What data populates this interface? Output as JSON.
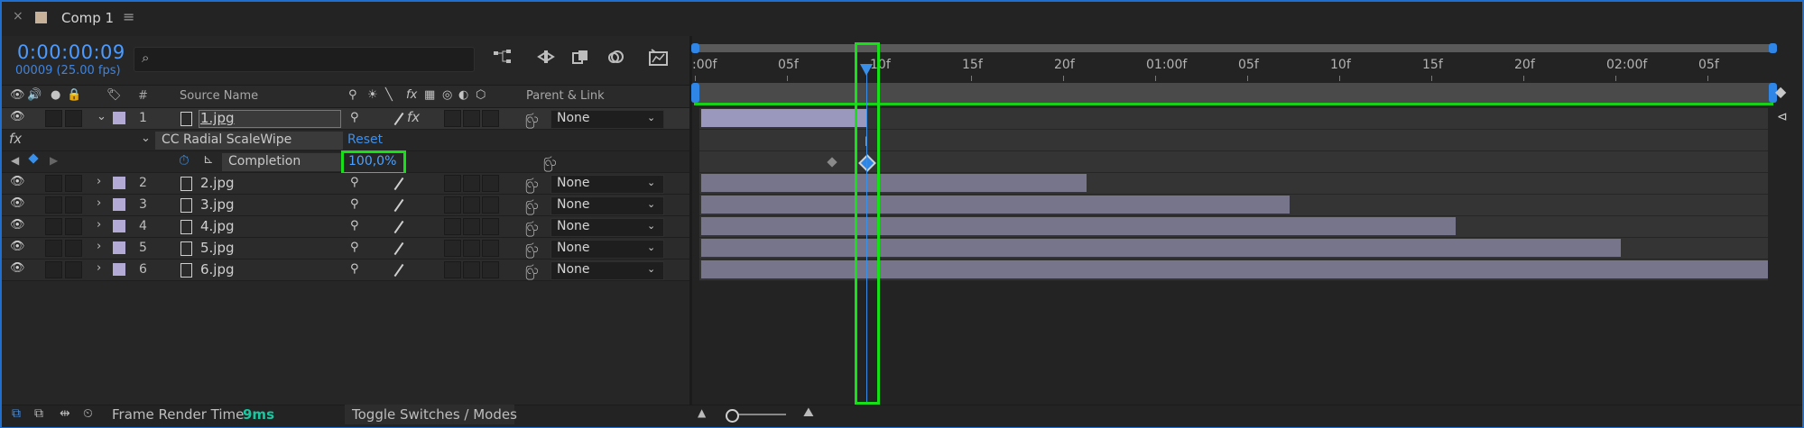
{
  "tab": {
    "close": "×",
    "title": "Comp 1",
    "menu": "≡"
  },
  "timecode": {
    "current": "0:00:00:09",
    "frames": "00009 (25.00 fps)"
  },
  "search": {
    "placeholder": "",
    "glyph": "⌕"
  },
  "columns": {
    "number": "#",
    "source_name": "Source Name",
    "parent_link": "Parent & Link"
  },
  "layers": [
    {
      "number": "1",
      "name": "1.jpg",
      "parent": "None"
    },
    {
      "number": "2",
      "name": "2.jpg",
      "parent": "None"
    },
    {
      "number": "3",
      "name": "3.jpg",
      "parent": "None"
    },
    {
      "number": "4",
      "name": "4.jpg",
      "parent": "None"
    },
    {
      "number": "5",
      "name": "5.jpg",
      "parent": "None"
    },
    {
      "number": "6",
      "name": "6.jpg",
      "parent": "None"
    }
  ],
  "effect": {
    "fx_label": "fx",
    "name": "CC Radial ScaleWipe",
    "reset": "Reset",
    "property": "Completion",
    "value": "100,0%"
  },
  "ruler": {
    "labels": [
      ":00f",
      "05f",
      "10f",
      "15f",
      "20f",
      "01:00f",
      "05f",
      "10f",
      "15f",
      "20f",
      "02:00f",
      "05f"
    ]
  },
  "layer_bars": {
    "unit": "fraction_of_timeline",
    "ends": [
      0.155,
      0.361,
      0.552,
      0.707,
      0.862,
      1.0
    ]
  },
  "keyframes": {
    "unit": "fraction_of_timeline",
    "positions": [
      0.123,
      0.155
    ]
  },
  "footer": {
    "render_label": "Frame Render Time",
    "render_value": "9ms",
    "toggle": "Toggle Switches / Modes"
  },
  "colors": {
    "accent": "#3a8fe8",
    "highlight": "#18e018",
    "label_swatch": "#b3abd6",
    "render_time": "#17c7a0"
  }
}
